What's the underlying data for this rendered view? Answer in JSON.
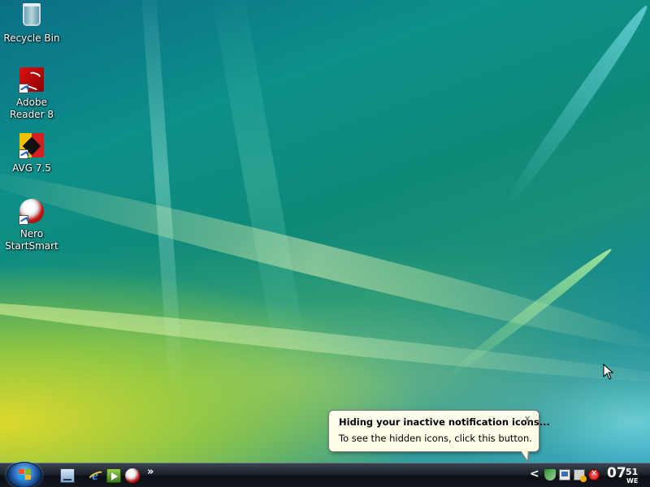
{
  "desktop": {
    "icons": [
      {
        "label": "Recycle Bin",
        "icon": "recycle-bin-icon"
      },
      {
        "label": "Adobe Reader 8",
        "icon": "adobe-reader-icon"
      },
      {
        "label": "AVG 7.5",
        "icon": "avg-icon"
      },
      {
        "label": "Nero StartSmart",
        "icon": "nero-icon"
      }
    ]
  },
  "taskbar": {
    "start_icon": "windows-start-orb",
    "quick_launch": [
      {
        "icon": "show-desktop-icon"
      },
      {
        "icon": "internet-explorer-icon",
        "glyph": "e"
      },
      {
        "icon": "media-center-icon"
      },
      {
        "icon": "nero-icon"
      }
    ],
    "more_glyph": "»",
    "tray": {
      "expand_glyph": "<",
      "icons": [
        "shield-icon",
        "network-icon",
        "security-center-icon",
        "avg-icon"
      ],
      "clock": {
        "hour": "07",
        "minute": "51",
        "day": "WE"
      }
    }
  },
  "balloon": {
    "title": "Hiding your inactive notification icons...",
    "text": "To see the hidden icons, click this button.",
    "close_glyph": "x"
  }
}
